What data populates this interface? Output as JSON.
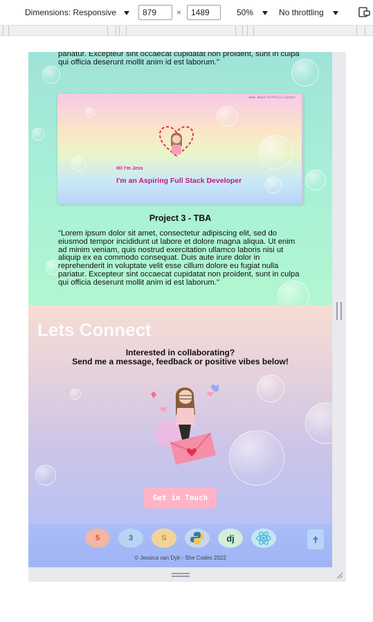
{
  "devtools": {
    "dimensions_label": "Dimensions: Responsive",
    "width": "879",
    "height": "1489",
    "times": "×",
    "zoom": "50%",
    "throttling": "No throttling"
  },
  "projects": {
    "prev_paragraph_tail": "pariatur. Excepteur sint occaecat cupidatat non proident, sunt in culpa qui officia deserunt mollit anim id est laborum.\"",
    "screenshot": {
      "nav": "Home About Portfolio Contact",
      "greeting": "Hi! I'm Jess",
      "headline": "I'm an Aspiring Full Stack Developer"
    },
    "project3_title": "Project 3 - TBA",
    "project3_text": "\"Lorem ipsum dolor sit amet, consectetur adipiscing elit, sed do eiusmod tempor incididunt ut labore et dolore magna aliqua. Ut enim ad minim veniam, quis nostrud exercitation ullamco laboris nisi ut aliquip ex ea commodo consequat. Duis aute irure dolor in reprehenderit in voluptate velit esse cillum dolore eu fugiat nulla pariatur. Excepteur sint occaecat cupidatat non proident, sunt in culpa qui officia deserunt mollit anim id est laborum.\""
  },
  "connect": {
    "title": "Lets Connect",
    "line1": "Interested in collaborating?",
    "line2": "Send me a message, feedback or positive vibes below!",
    "button": "Get in Touch"
  },
  "footer": {
    "icons": [
      "html5-icon",
      "css3-icon",
      "sass-icon",
      "python-icon",
      "django-icon",
      "react-icon"
    ],
    "django_text": "dj",
    "copyright": "© Jessica van Dyk - She Codes 2022",
    "up_icon": "arrow-up-icon"
  },
  "colors": {
    "projects_bg": "#a8efd8",
    "connect_bg": "#cdc4e8",
    "footer_bg": "#a9bdf8",
    "button_bg": "#ffb3c6",
    "accent_pink": "#c2187f"
  }
}
